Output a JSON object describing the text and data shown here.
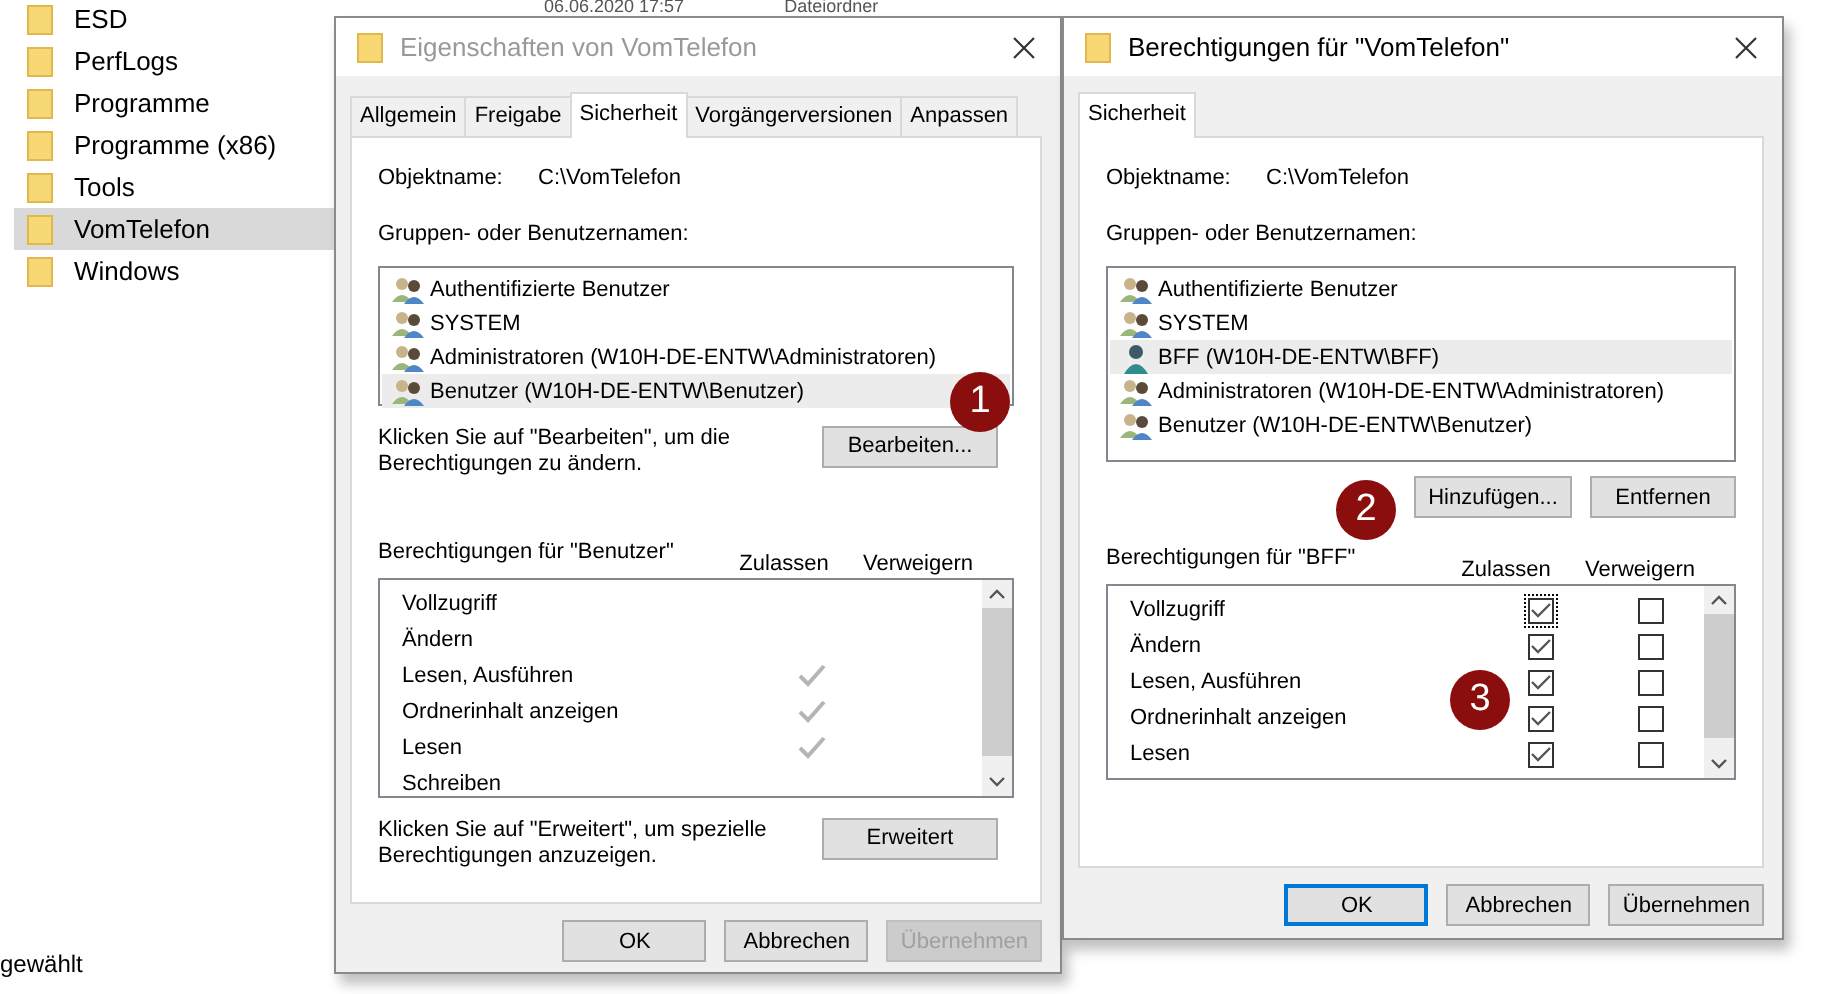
{
  "explorer": {
    "header_cells": [
      "06.06.2020 17:57",
      "Dateiordner"
    ],
    "folders": [
      {
        "name": "ESD",
        "selected": false
      },
      {
        "name": "PerfLogs",
        "selected": false
      },
      {
        "name": "Programme",
        "selected": false
      },
      {
        "name": "Programme (x86)",
        "selected": false
      },
      {
        "name": "Tools",
        "selected": false
      },
      {
        "name": "VomTelefon",
        "selected": true
      },
      {
        "name": "Windows",
        "selected": false
      }
    ],
    "status_text": "gewählt"
  },
  "dialogs": [
    {
      "title": "Eigenschaften von VomTelefon",
      "active": false,
      "tabs": [
        {
          "label": "Allgemein",
          "selected": false
        },
        {
          "label": "Freigabe",
          "selected": false
        },
        {
          "label": "Sicherheit",
          "selected": true
        },
        {
          "label": "Vorgängerversionen",
          "selected": false
        },
        {
          "label": "Anpassen",
          "selected": false
        }
      ],
      "object_label": "Objektname:",
      "object_value": "C:\\VomTelefon",
      "groups_label": "Gruppen- oder Benutzernamen:",
      "groups": [
        {
          "name": "Authentifizierte Benutzer",
          "kind": "group",
          "selected": false
        },
        {
          "name": "SYSTEM",
          "kind": "group",
          "selected": false
        },
        {
          "name": "Administratoren (W10H-DE-ENTW\\Administratoren)",
          "kind": "group",
          "selected": false
        },
        {
          "name": "Benutzer (W10H-DE-ENTW\\Benutzer)",
          "kind": "group",
          "selected": true
        }
      ],
      "group_actions": {
        "kind": "hint",
        "hint": "Klicken Sie auf \"Bearbeiten\", um die Berechtigungen zu ändern.",
        "buttons": [
          "Bearbeiten..."
        ]
      },
      "permissions_label": "Berechtigungen für \"Benutzer\"",
      "allow_header": "Zulassen",
      "deny_header": "Verweigern",
      "permissions": [
        {
          "name": "Vollzugriff",
          "kind": "inherited",
          "allow": false,
          "deny": false
        },
        {
          "name": "Ändern",
          "kind": "inherited",
          "allow": false,
          "deny": false
        },
        {
          "name": "Lesen, Ausführen",
          "kind": "inherited",
          "allow": true,
          "deny": false
        },
        {
          "name": "Ordnerinhalt anzeigen",
          "kind": "inherited",
          "allow": true,
          "deny": false
        },
        {
          "name": "Lesen",
          "kind": "inherited",
          "allow": true,
          "deny": false
        },
        {
          "name": "Schreiben",
          "kind": "inherited",
          "allow": false,
          "deny": false
        }
      ],
      "advanced": {
        "hint": "Klicken Sie auf \"Erweitert\", um spezielle Berechtigungen anzuzeigen.",
        "button": "Erweitert"
      },
      "buttons": [
        {
          "label": "OK",
          "default": false,
          "disabled": false
        },
        {
          "label": "Abbrechen",
          "default": false,
          "disabled": false
        },
        {
          "label": "Übernehmen",
          "default": false,
          "disabled": true
        }
      ]
    },
    {
      "title": "Berechtigungen für \"VomTelefon\"",
      "active": true,
      "tabs": [
        {
          "label": "Sicherheit",
          "selected": true
        }
      ],
      "object_label": "Objektname:",
      "object_value": "C:\\VomTelefon",
      "groups_label": "Gruppen- oder Benutzernamen:",
      "groups": [
        {
          "name": "Authentifizierte Benutzer",
          "kind": "group",
          "selected": false
        },
        {
          "name": "SYSTEM",
          "kind": "group",
          "selected": false
        },
        {
          "name": "BFF (W10H-DE-ENTW\\BFF)",
          "kind": "user",
          "selected": true
        },
        {
          "name": "Administratoren (W10H-DE-ENTW\\Administratoren)",
          "kind": "group",
          "selected": false
        },
        {
          "name": "Benutzer (W10H-DE-ENTW\\Benutzer)",
          "kind": "group",
          "selected": false
        }
      ],
      "group_actions": {
        "kind": "buttons",
        "buttons": [
          "Hinzufügen...",
          "Entfernen"
        ]
      },
      "permissions_label": "Berechtigungen für \"BFF\"",
      "allow_header": "Zulassen",
      "deny_header": "Verweigern",
      "permissions": [
        {
          "name": "Vollzugriff",
          "kind": "checkbox",
          "allow": true,
          "deny": false,
          "focused": true
        },
        {
          "name": "Ändern",
          "kind": "checkbox",
          "allow": true,
          "deny": false,
          "focused": false
        },
        {
          "name": "Lesen, Ausführen",
          "kind": "checkbox",
          "allow": true,
          "deny": false,
          "focused": false
        },
        {
          "name": "Ordnerinhalt anzeigen",
          "kind": "checkbox",
          "allow": true,
          "deny": false,
          "focused": false
        },
        {
          "name": "Lesen",
          "kind": "checkbox",
          "allow": true,
          "deny": false,
          "focused": false
        }
      ],
      "buttons": [
        {
          "label": "OK",
          "default": true,
          "disabled": false
        },
        {
          "label": "Abbrechen",
          "default": false,
          "disabled": false
        },
        {
          "label": "Übernehmen",
          "default": false,
          "disabled": false
        }
      ]
    }
  ],
  "callouts": [
    "1",
    "2",
    "3"
  ]
}
